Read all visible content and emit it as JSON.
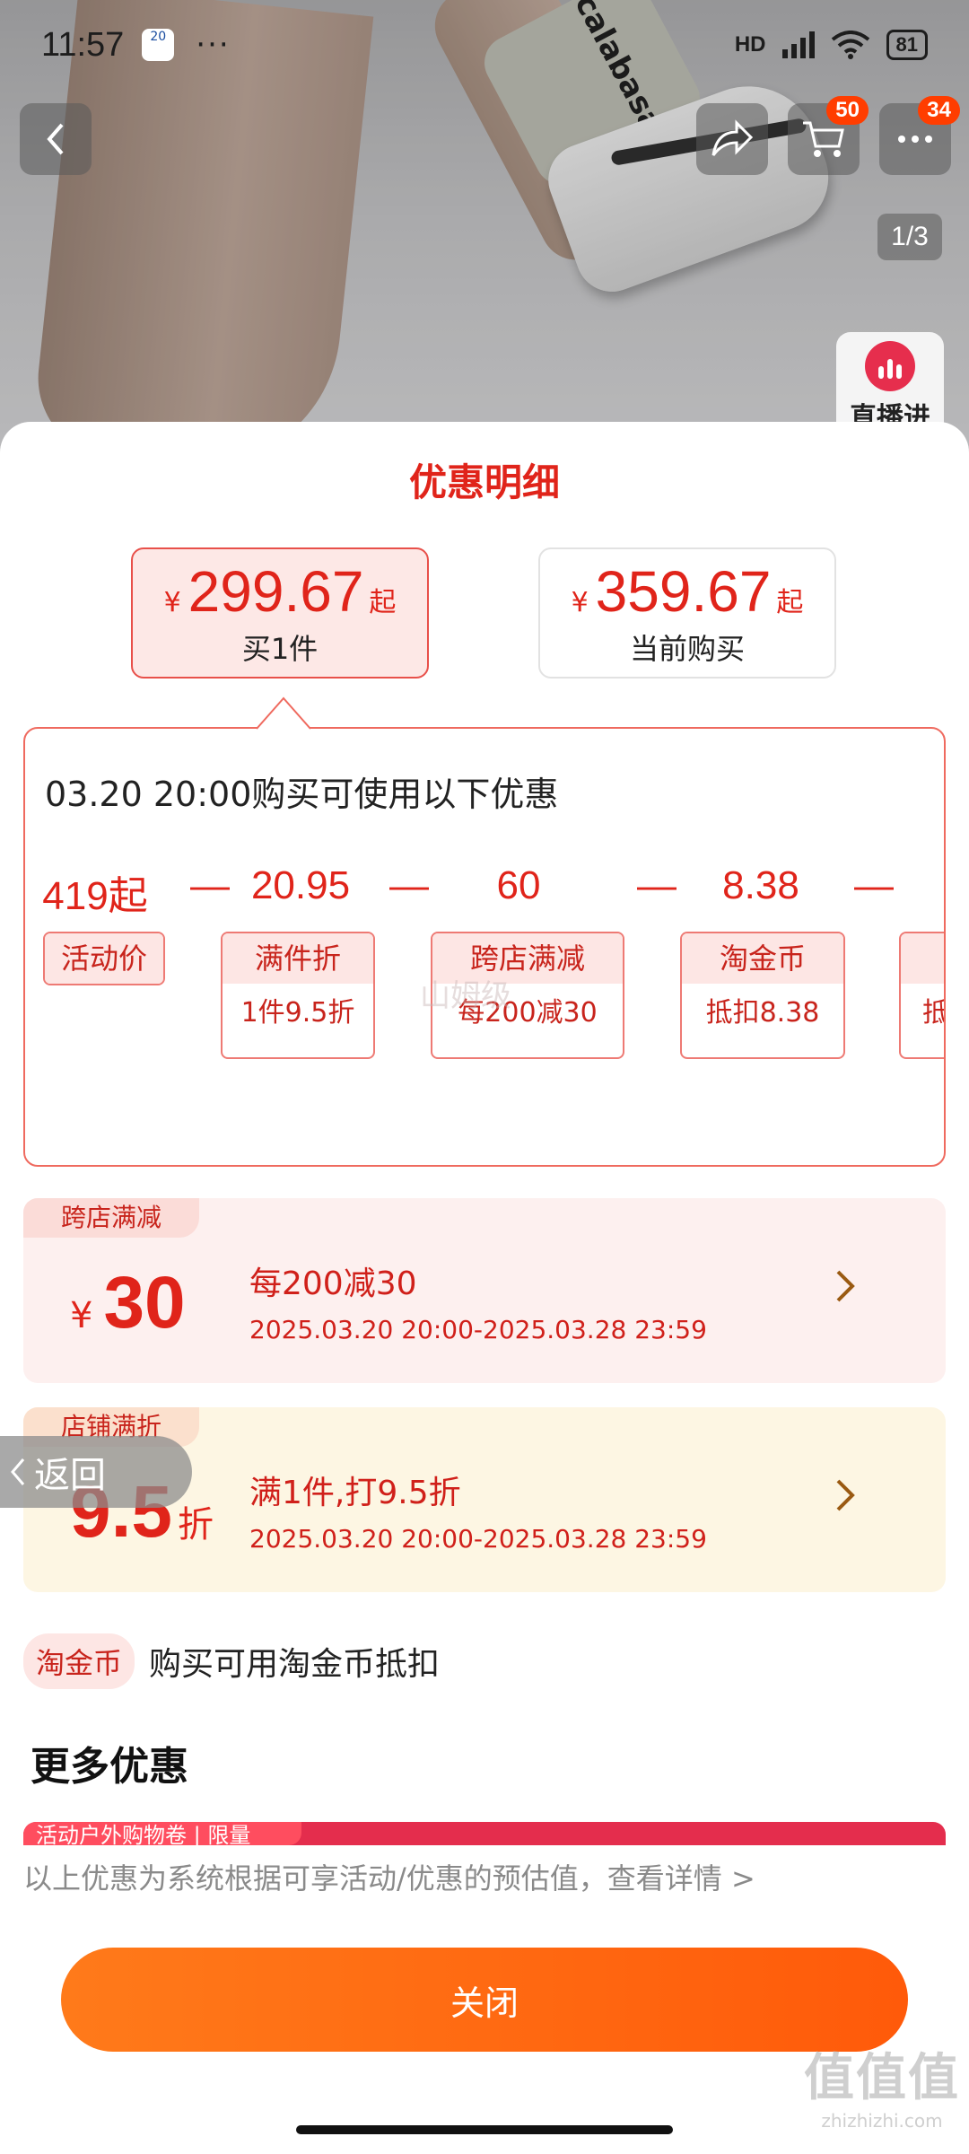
{
  "status_bar": {
    "time": "11:57",
    "notif": "20",
    "dots": "···",
    "network": "HD",
    "battery": "81"
  },
  "product": {
    "sock_text": "calabasas",
    "cart_badge": "50",
    "msg_badge": "34",
    "pager": "1/3",
    "live_label": "直播进"
  },
  "sheet": {
    "title": "优惠明细",
    "options": [
      {
        "yen": "¥",
        "price": "299.67",
        "suffix": "起",
        "sub": "买1件"
      },
      {
        "yen": "¥",
        "price": "359.67",
        "suffix": "起",
        "sub": "当前购买"
      }
    ],
    "panel": {
      "headline": "03.20 20:00购买可使用以下优惠",
      "values": [
        "419起",
        "20.95",
        "60",
        "8.38"
      ],
      "minus": "—",
      "tags": [
        {
          "title": "活动价"
        },
        {
          "title": "满件折",
          "detail": "1件9.5折"
        },
        {
          "title": "跨店满减",
          "detail": "每200减30"
        },
        {
          "title": "淘金币",
          "detail": "抵扣8.38"
        },
        {
          "title": "",
          "detail": "抵"
        }
      ],
      "watermark": "山姆级"
    },
    "cards": [
      {
        "tag": "跨店满减",
        "yen": "¥",
        "amount": "30",
        "suffix": "",
        "line1": "每200减30",
        "line2": "2025.03.20 20:00-2025.03.28 23:59"
      },
      {
        "tag": "店铺满折",
        "yen": "",
        "amount": "9.5",
        "suffix": "折",
        "line1": "满1件,打9.5折",
        "line2": "2025.03.20 20:00-2025.03.28 23:59"
      }
    ],
    "back_float": "返回",
    "taojinbi": {
      "pill": "淘金币",
      "text": "购买可用淘金币抵扣"
    },
    "more_title": "更多优惠",
    "strip_text": "活动户外购物卷 | 限量",
    "disclaimer": "以上优惠为系统根据可享活动/优惠的预估值，查看详情 >",
    "close_label": "关闭"
  },
  "watermark_site": {
    "big": "值值值",
    "small": "zhizhizhi.com"
  }
}
